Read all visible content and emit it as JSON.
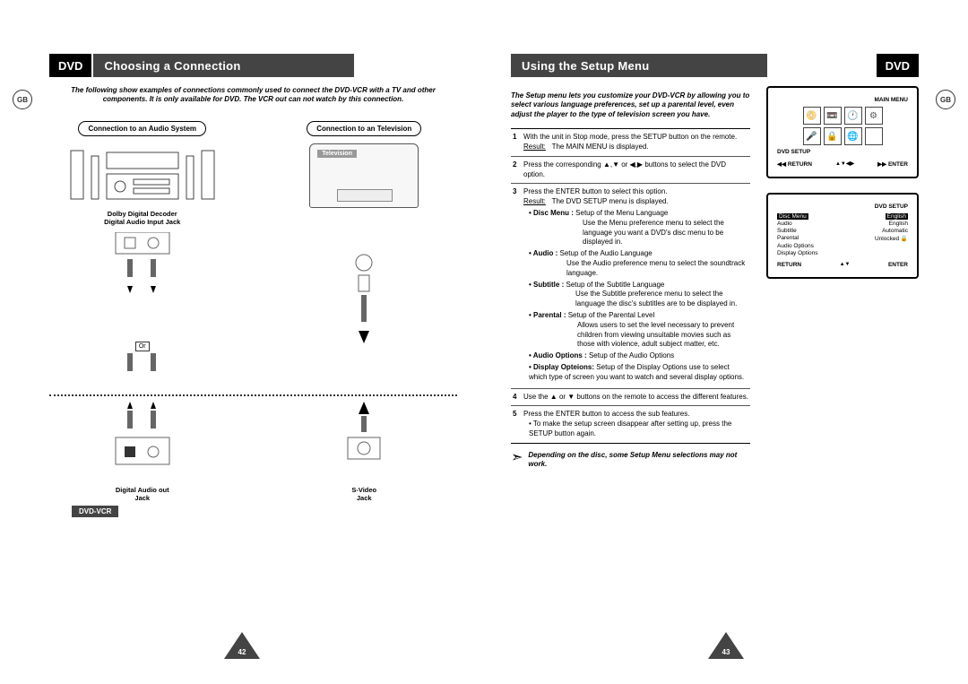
{
  "left": {
    "dvd_tag": "DVD",
    "title": "Choosing a Connection",
    "gb_badge": "GB",
    "intro": "The following show examples of connections commonly used to connect the DVD-VCR with a TV and other components. It is only available for DVD. The VCR out can not watch by this connection.",
    "conn_audio_label": "Connection to an Audio System",
    "conn_tv_label": "Connection to an Television",
    "dolby_caption_l1": "Dolby Digital Decoder",
    "dolby_caption_l2": "Digital Audio Input Jack",
    "television_label": "Television",
    "or_label": "Or",
    "dvdvcr_label": "DVD-VCR",
    "digital_audio_out_l1": "Digital Audio out",
    "digital_audio_out_l2": "Jack",
    "svideo_l1": "S-Video",
    "svideo_l2": "Jack",
    "page_num": "42"
  },
  "right": {
    "dvd_tag": "DVD",
    "title": "Using the Setup Menu",
    "gb_badge": "GB",
    "intro": "The Setup menu lets you customize your DVD-VCR by allowing you to select various language preferences, set up a parental level, even adjust the player to the type of television screen you have.",
    "steps": {
      "s1": {
        "num": "1",
        "text": "With the unit in Stop mode, press the SETUP button on the remote.",
        "result_label": "Result:",
        "result_text": "The MAIN MENU is displayed."
      },
      "s2": {
        "num": "2",
        "text_a": "Press the corresponding ",
        "text_b": " buttons to select the DVD option."
      },
      "s3": {
        "num": "3",
        "line1": "Press the ENTER button to select this option.",
        "result_label": "Result:",
        "result_text": "The DVD SETUP  menu is displayed.",
        "disc_menu_lead": "• Disc Menu :",
        "disc_menu_text": "Setup of the Menu Language",
        "disc_menu_desc": "Use the Menu preference menu to select the language you want a DVD's disc menu to be displayed in.",
        "audio_lead": "• Audio :",
        "audio_text": "Setup of the Audio Language",
        "audio_desc": "Use the Audio preference menu to select the soundtrack language.",
        "subtitle_lead": "• Subtitle :",
        "subtitle_text": "Setup of the Subtitle Language",
        "subtitle_desc": "Use the Subtitle preference menu to select the language the disc's subtitles are to be displayed in.",
        "parental_lead": "• Parental :",
        "parental_text": "Setup of the Parental Level",
        "parental_desc": "Allows users to set the level necessary to prevent children from viewing unsuitable movies such as those with violence, adult subject matter, etc.",
        "audioopt_lead": "• Audio Options :",
        "audioopt_text": "Setup of the Audio Options",
        "display_lead": "• Display Opteions:",
        "display_text": "Setup of the Display Options use to select which type of screen you want to watch and several display options."
      },
      "s4": {
        "num": "4",
        "text_a": "Use the ",
        "text_b": " buttons on the remote to access the different features."
      },
      "s5": {
        "num": "5",
        "line1": "Press the ENTER button to access the sub features.",
        "bullet": "• To make the setup screen disappear after setting up, press the SETUP button again."
      }
    },
    "note": "Depending on the disc, some Setup Menu selections may not work.",
    "osd1": {
      "title": "MAIN MENU",
      "dvd_setup": "DVD SETUP",
      "return": "RETURN",
      "enter": "ENTER"
    },
    "osd2": {
      "title": "DVD SETUP",
      "rows": [
        {
          "k": "Disc Menu",
          "v": "English"
        },
        {
          "k": "Audio",
          "v": "English"
        },
        {
          "k": "Subtitle",
          "v": "Automatic"
        },
        {
          "k": "Parental",
          "v": "Unlocked 🔒"
        },
        {
          "k": "Audio Options",
          "v": ""
        },
        {
          "k": "Display Options",
          "v": ""
        }
      ],
      "return": "RETURN",
      "enter": "ENTER"
    },
    "page_num": "43"
  }
}
